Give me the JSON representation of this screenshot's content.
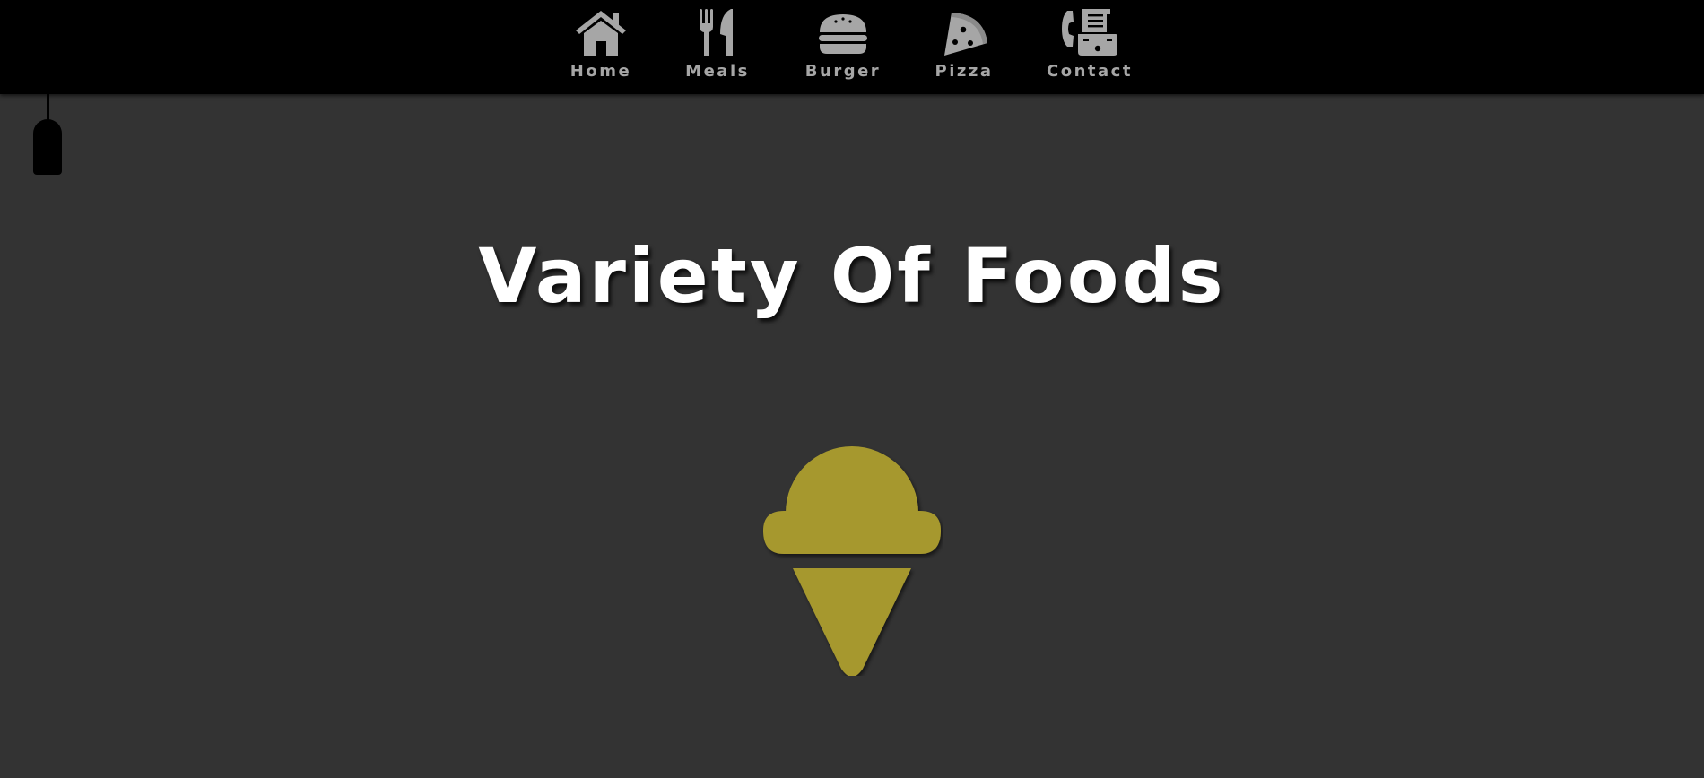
{
  "nav": {
    "items": [
      {
        "label": "Home",
        "icon": "house-icon"
      },
      {
        "label": "Meals",
        "icon": "utensils-icon"
      },
      {
        "label": "Burger",
        "icon": "burger-icon"
      },
      {
        "label": "Pizza",
        "icon": "pizza-slice-icon"
      },
      {
        "label": "Contact",
        "icon": "fax-phone-icon"
      }
    ]
  },
  "lamp": {
    "icon": "hanging-lamp-icon"
  },
  "hero": {
    "title": "Variety Of Foods",
    "icon": "ice-cream-cone-icon"
  },
  "colors": {
    "navbar_bg": "#000000",
    "page_bg": "#333333",
    "nav_text": "#a6a6a6",
    "title_text": "#ffffff",
    "icecream": "#a6982f"
  }
}
